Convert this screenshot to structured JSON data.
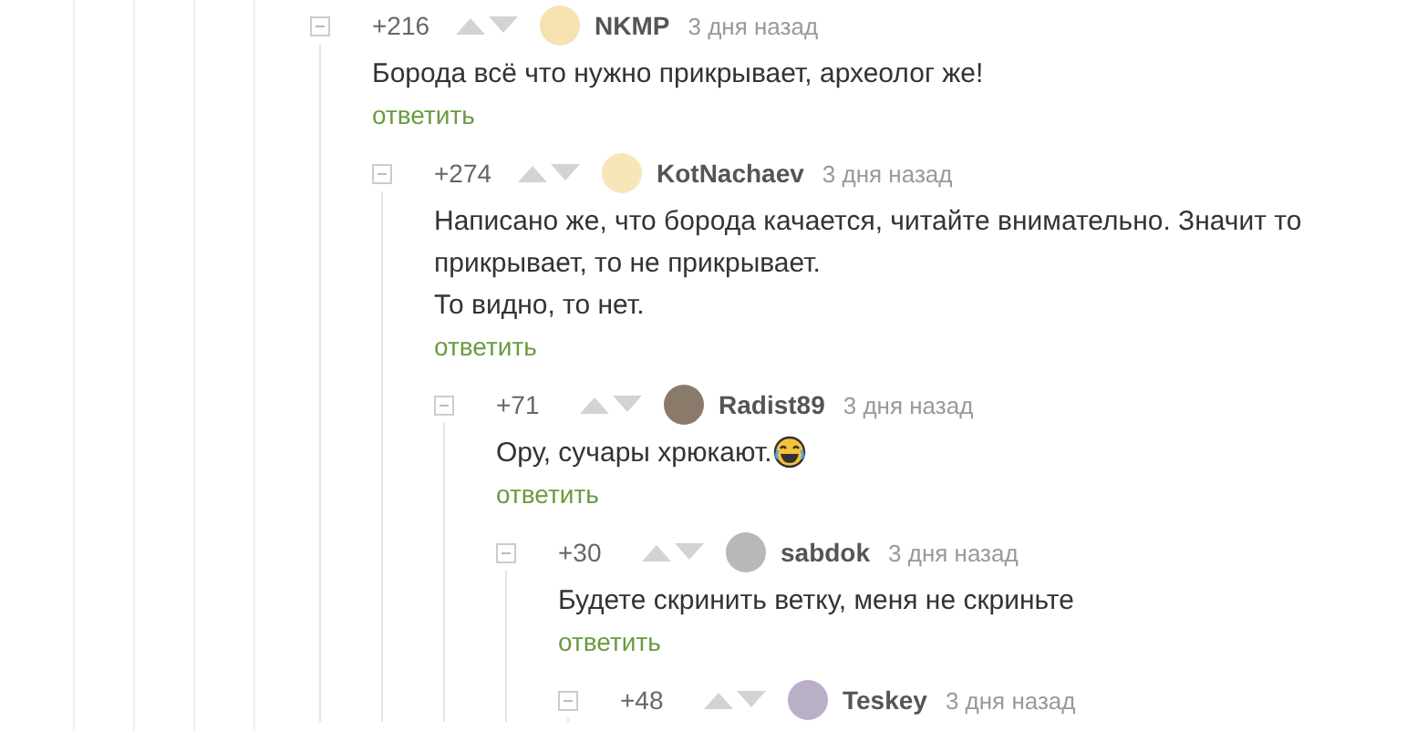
{
  "comments": [
    {
      "rating": "+216",
      "author": "NKMP",
      "time": "3 дня назад",
      "text": [
        "Борода всё что нужно прикрывает, археолог же!"
      ],
      "reply": "ответить",
      "children": [
        {
          "rating": "+274",
          "author": "KotNachaev",
          "time": "3 дня назад",
          "text": [
            "Написано же, что борода качается, читайте внимательно. Значит то прикрывает, то не прикрывает.",
            "То видно, то нет."
          ],
          "reply": "ответить",
          "children": [
            {
              "rating": "+71",
              "author": "Radist89",
              "time": "3 дня назад",
              "text": [
                "Ору, сучары хрюкают."
              ],
              "emoji": true,
              "reply": "ответить",
              "children": [
                {
                  "rating": "+30",
                  "author": "sabdok",
                  "time": "3 дня назад",
                  "text": [
                    "Будете скринить ветку, меня не скриньте"
                  ],
                  "reply": "ответить",
                  "children": [
                    {
                      "rating": "+48",
                      "author": "Teskey",
                      "time": "3 дня назад"
                    }
                  ]
                }
              ]
            }
          ]
        }
      ]
    }
  ]
}
